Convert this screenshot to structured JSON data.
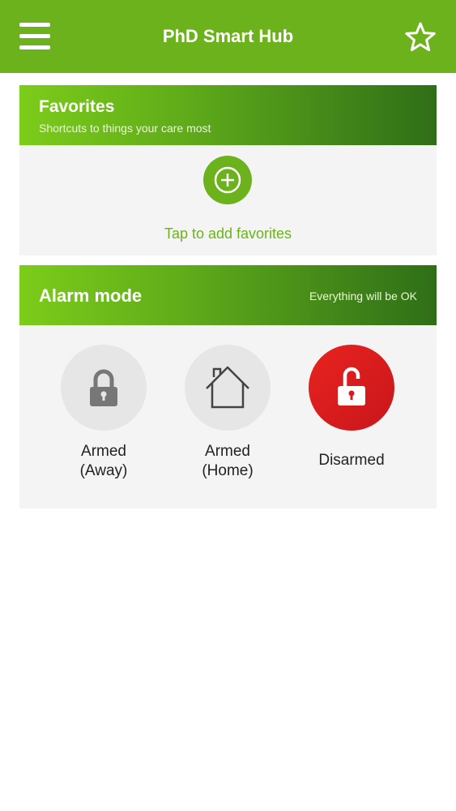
{
  "app": {
    "title": "PhD Smart Hub",
    "accent_color": "#6cb21c",
    "menu_icon": "hamburger-menu-icon",
    "favorites_icon": "star-outline-icon"
  },
  "favorites": {
    "title": "Favorites",
    "subtitle": "Shortcuts to things your care most",
    "add_label": "Tap to add favorites",
    "add_icon": "plus-circle-icon"
  },
  "alarm": {
    "title": "Alarm mode",
    "status": "Everything will be OK",
    "modes": [
      {
        "label_line1": "Armed",
        "label_line2": "(Away)",
        "icon": "lock-closed-icon",
        "active": false
      },
      {
        "label_line1": "Armed",
        "label_line2": "(Home)",
        "icon": "house-icon",
        "active": false
      },
      {
        "label_line1": "Disarmed",
        "label_line2": "",
        "icon": "lock-open-icon",
        "active": true,
        "active_color": "#e01e1e"
      }
    ]
  }
}
